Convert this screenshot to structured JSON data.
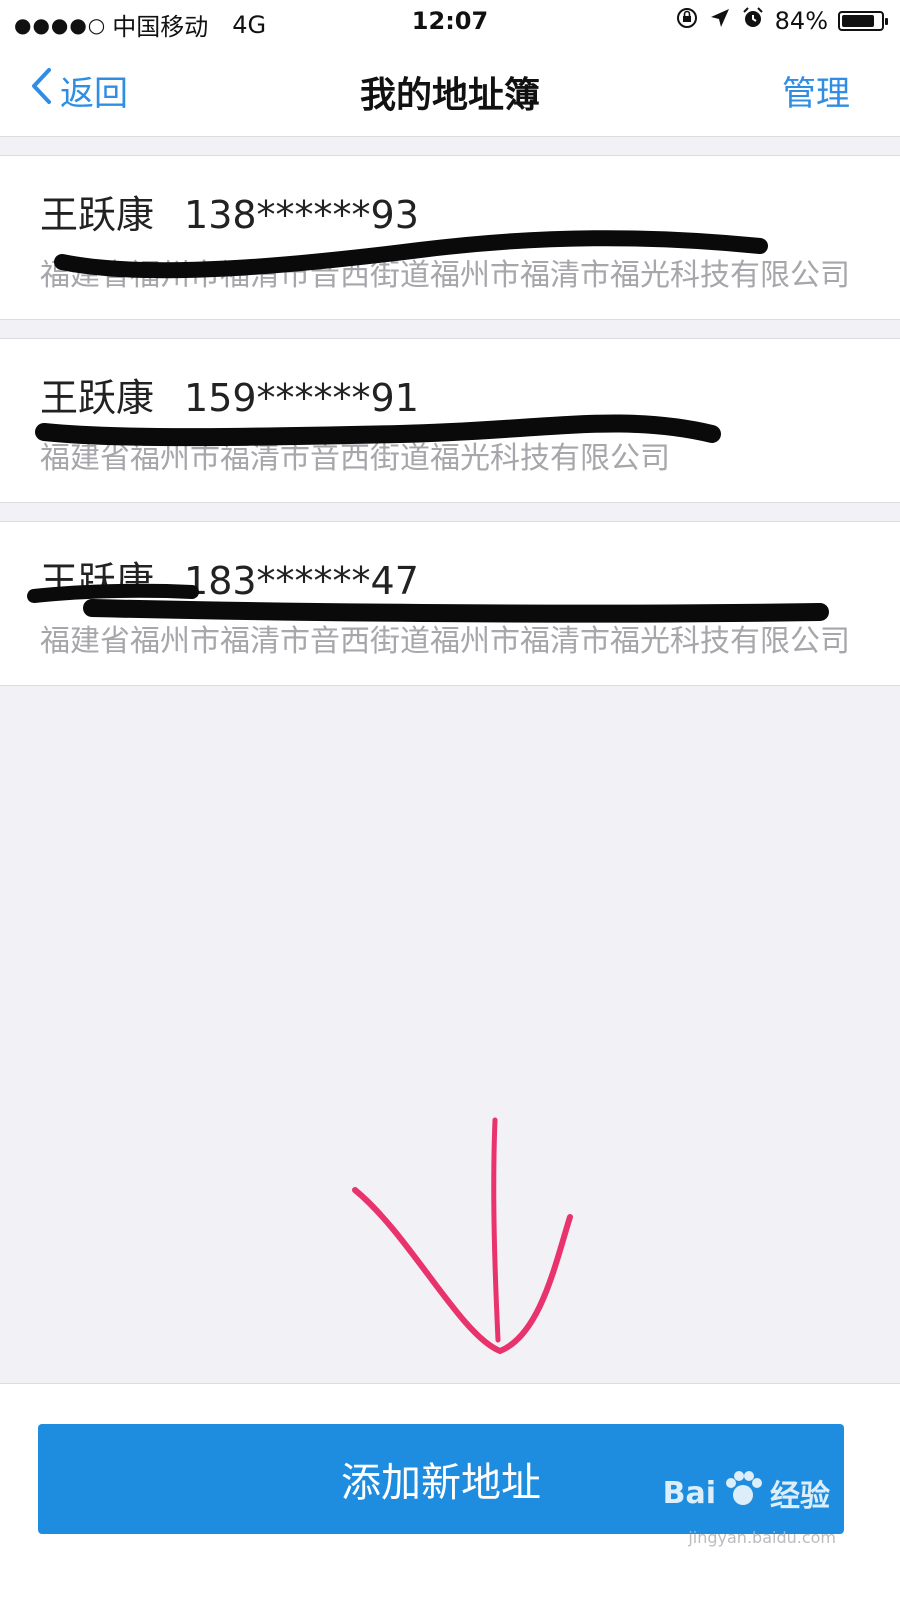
{
  "status_bar": {
    "carrier": "中国移动",
    "network": "4G",
    "time": "12:07",
    "battery_percent": "84%",
    "battery_level": 0.84
  },
  "navbar": {
    "back_label": "返回",
    "title": "我的地址簿",
    "manage_label": "管理"
  },
  "addresses": [
    {
      "name": "王跃康",
      "phone": "138******93",
      "address": "福建省福州市福清市音西街道福州市福清市福光科技有限公司"
    },
    {
      "name": "王跃康",
      "phone": "159******91",
      "address": "福建省福州市福清市音西街道福光科技有限公司"
    },
    {
      "name": "王跃康",
      "phone": "183******47",
      "address": "福建省福州市福清市音西街道福州市福清市福光科技有限公司"
    }
  ],
  "bottom": {
    "add_button_label": "添加新地址"
  },
  "watermark": {
    "brand": "Bai",
    "brand_suffix": "经验",
    "url": "jingyan.baidu.com"
  },
  "colors": {
    "accent": "#2f8ee3",
    "button": "#1e8de0",
    "annotation_arrow": "#e8336d",
    "redaction": "#0a0a0a"
  }
}
